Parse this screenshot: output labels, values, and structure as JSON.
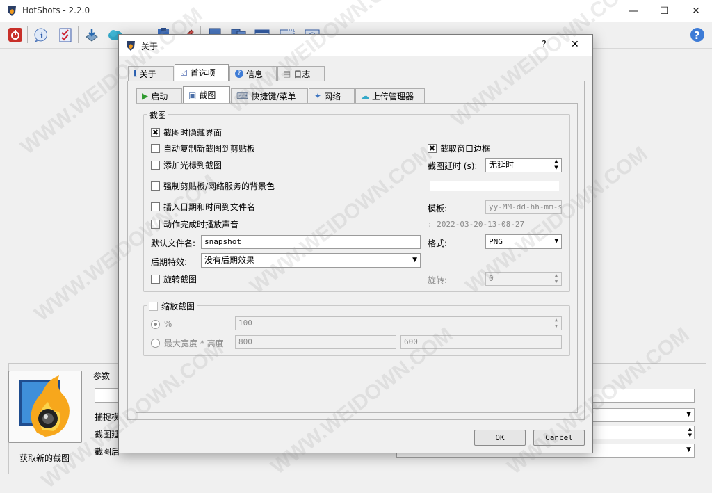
{
  "main_window": {
    "title": "HotShots - 2.2.0",
    "capture_button_label": "获取新的截图",
    "params_legend": "参数",
    "params_rows": [
      "捕捉模",
      "截图延",
      "截图后"
    ]
  },
  "dialog": {
    "title": "关于",
    "help_glyph": "?",
    "close_glyph": "✕",
    "tabs": [
      "关于",
      "首选项",
      "信息",
      "日志"
    ],
    "subtabs": [
      "启动",
      "截图",
      "快捷键/菜单",
      "网络",
      "上传管理器"
    ],
    "screenshot_group": {
      "legend": "截图",
      "hide_ui": {
        "label": "截图时隐藏界面",
        "checked": true
      },
      "auto_copy": {
        "label": "自动复制新截图到剪贴板",
        "checked": false
      },
      "add_cursor": {
        "label": "添加光标到截图",
        "checked": false
      },
      "force_bg": {
        "label": "强制剪贴板/网络服务的背景色",
        "checked": false
      },
      "insert_datetime": {
        "label": "插入日期和时间到文件名",
        "checked": false
      },
      "play_sound": {
        "label": "动作完成时播放声音",
        "checked": false
      },
      "capture_border": {
        "label": "截取窗口边框",
        "checked": true
      },
      "delay_label": "截图延时 (s):",
      "delay_value": "无延时",
      "template_label": "模板:",
      "template_value": "yy-MM-dd-hh-mm-ss",
      "template_example": ": 2022-03-20-13-08-27",
      "default_name_label": "默认文件名:",
      "default_name_value": "snapshot",
      "format_label": "格式:",
      "format_value": "PNG",
      "post_effect_label": "后期特效:",
      "post_effect_value": "没有后期效果",
      "rotate": {
        "label": "旋转截图",
        "checked": false
      },
      "rotate_angle_label": "旋转:",
      "rotate_angle_value": "0"
    },
    "scale_group": {
      "legend": "缩放截图",
      "checked": false,
      "percent_label": "%",
      "percent_value": "100",
      "max_label": "最大宽度 * 高度",
      "max_width": "800",
      "max_height": "600"
    },
    "buttons": {
      "ok": "OK",
      "cancel": "Cancel"
    }
  },
  "watermark_text": "WWW.WEIDOWN.COM"
}
